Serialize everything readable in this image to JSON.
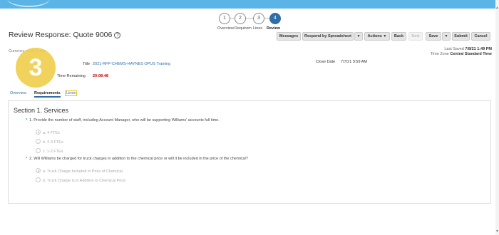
{
  "train": {
    "steps": [
      {
        "number": "1",
        "label": "Overview"
      },
      {
        "number": "2",
        "label": "Requirem"
      },
      {
        "number": "3",
        "label": "Lines"
      },
      {
        "number": "4",
        "label": "Review"
      }
    ]
  },
  "header": {
    "title": "Review Response: Quote 9006"
  },
  "toolbar": {
    "messages": "Messages",
    "respond_by_spreadsheet": "Respond by Spreadsheet",
    "actions": "Actions",
    "back": "Back",
    "next": "Next",
    "save": "Save",
    "submit": "Submit",
    "cancel": "Cancel"
  },
  "info": {
    "currency": "Currency = US Dollar",
    "last_saved_label": "Last Saved",
    "last_saved_value": "7/8/21 1:49 PM",
    "time_zone_label": "Time Zone",
    "time_zone_value": "Central Standard Time",
    "title_label": "Title",
    "title_value": "2021-RFP-CHEMS-HAYNES OPUS Training",
    "close_date_label": "Close Date",
    "close_date_value": "7/7/21 9:59 AM",
    "time_remaining_label": "Time Remaining",
    "time_remaining_value": "20:08:48"
  },
  "step_badge": "3",
  "tabs": [
    {
      "label": "Overview"
    },
    {
      "label": "Requirements"
    },
    {
      "label": "Lines"
    }
  ],
  "section": {
    "title": "Section 1. Services",
    "questions": [
      {
        "number": "1.",
        "text": "Provide the number of staff, including Account Manager, who will be supporting Williams' accounts full time.",
        "options": [
          "a. 4 FTEs",
          "b. 2-3 FTEs",
          "c. 1-2 FTEs"
        ]
      },
      {
        "number": "2.",
        "text": "Will Williams be charged for truck charges in addition to the chemical price or will it be included in the price of the chemical?",
        "options": [
          "a. Truck Charge Included in Price of Chemical",
          "b. Truck Charge is in Addition to Chemical Price"
        ]
      }
    ]
  }
}
